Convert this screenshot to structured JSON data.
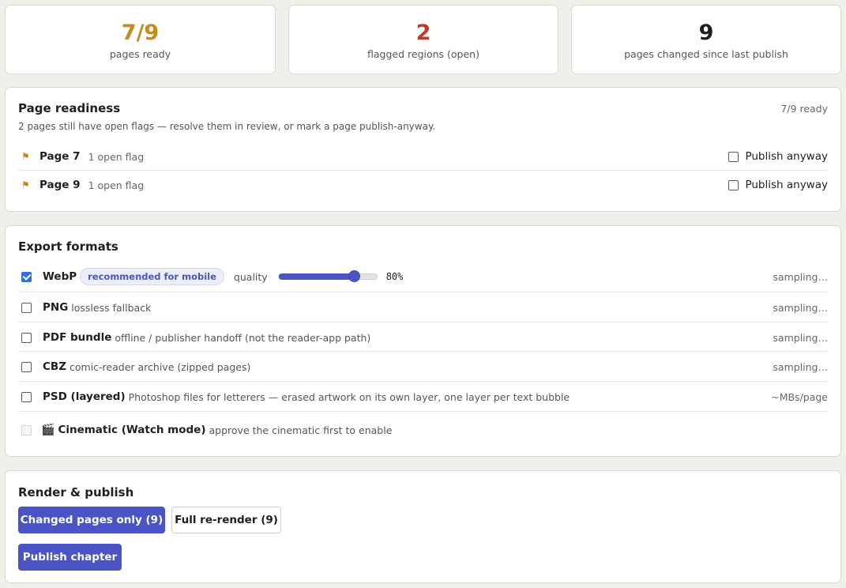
{
  "stats": [
    {
      "value": "7/9",
      "label": "pages ready",
      "color": "#c58a1a"
    },
    {
      "value": "2",
      "label": "flagged regions (open)",
      "color": "#c0392b"
    },
    {
      "value": "9",
      "label": "pages changed since last publish",
      "color": "#1f1f1f"
    }
  ],
  "readiness": {
    "title": "Page readiness",
    "summary": "7/9 ready",
    "subtitle": "2 pages still have open flags — resolve them in review, or mark a page publish-anyway.",
    "flag_icon": "flag-icon",
    "pages": [
      {
        "name": "Page 7",
        "note": "1 open flag",
        "action_label": "Publish anyway",
        "checked": false
      },
      {
        "name": "Page 9",
        "note": "1 open flag",
        "action_label": "Publish anyway",
        "checked": false
      }
    ]
  },
  "export": {
    "title": "Export formats",
    "formats": [
      {
        "name": "WebP",
        "badge": "recommended for mobile",
        "quality_label": "quality",
        "quality": 80,
        "quality_text": "80%",
        "note": "sampling…",
        "checked": true
      },
      {
        "name": "PNG",
        "desc": "lossless fallback",
        "note": "sampling…",
        "checked": false
      },
      {
        "name": "PDF bundle",
        "desc": "offline / publisher handoff (not the reader-app path)",
        "note": "sampling…",
        "checked": false
      },
      {
        "name": "CBZ",
        "desc": "comic-reader archive (zipped pages)",
        "note": "sampling…",
        "checked": false
      },
      {
        "name": "PSD (layered)",
        "desc": "Photoshop files for letterers — erased artwork on its own layer, one layer per text bubble",
        "note": "~MBs/page",
        "checked": false
      },
      {
        "name": "Cinematic (Watch mode)",
        "icon": "🎬",
        "desc": "approve the cinematic first to enable",
        "checked": false,
        "disabled": true
      }
    ]
  },
  "render": {
    "title": "Render & publish",
    "changed_only_label": "Changed pages only (9)",
    "full_rerender_label": "Full re-render (9)",
    "publish_label": "Publish chapter"
  },
  "colors": {
    "accent": "#4a54c4",
    "flag": "#c58a1a"
  }
}
